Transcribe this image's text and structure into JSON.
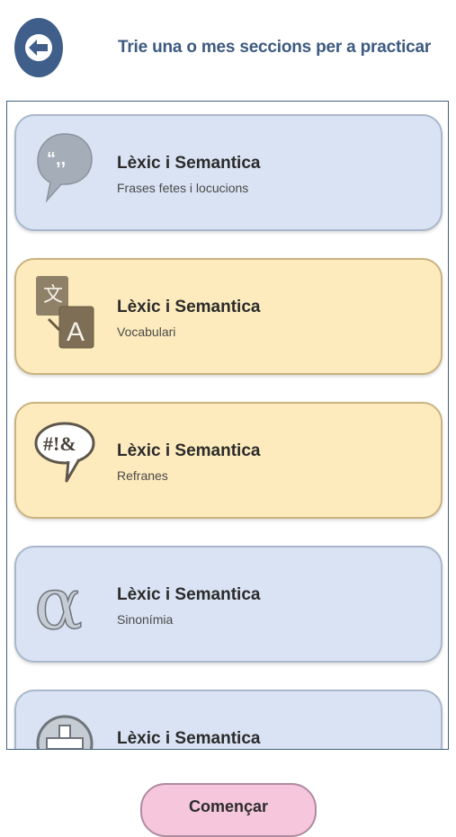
{
  "header": {
    "title": "Trie una o mes seccions per a practicar",
    "back_icon": "arrow-left-icon"
  },
  "colors": {
    "header_text": "#3d5a80",
    "back_button": "#3f5f8a",
    "card_blue": "#d9e3f3",
    "card_yellow": "#fdebbd",
    "start_button": "#f5c6dc"
  },
  "sections": [
    {
      "title": "Lèxic i Semantica",
      "subtitle": "Frases fetes i locucions",
      "icon": "speech-quote-icon",
      "selected": false
    },
    {
      "title": "Lèxic i Semantica",
      "subtitle": "Vocabulari",
      "icon": "translate-icon",
      "selected": true
    },
    {
      "title": "Lèxic i Semantica",
      "subtitle": "Refranes",
      "icon": "exclamation-speech-icon",
      "selected": true
    },
    {
      "title": "Lèxic i Semantica",
      "subtitle": "Sinonímia",
      "icon": "alpha-icon",
      "selected": false
    },
    {
      "title": "Lèxic i Semantica",
      "subtitle": "",
      "icon": "plus-circle-icon",
      "selected": false
    }
  ],
  "footer": {
    "start_label": "Començar"
  }
}
